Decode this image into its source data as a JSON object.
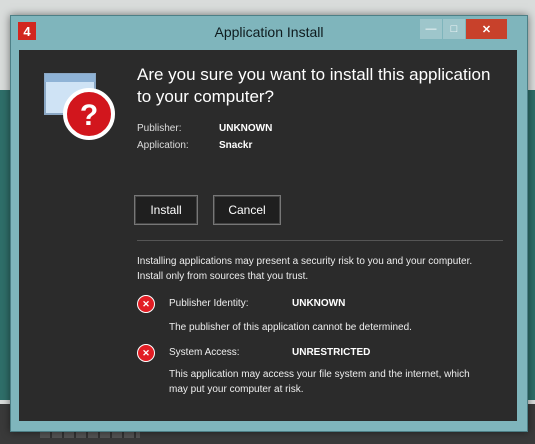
{
  "window": {
    "title": "Application Install",
    "app_icon_glyph": "4",
    "controls": {
      "minimize": "—",
      "maximize": "□",
      "close": "✕"
    }
  },
  "dialog": {
    "question": "Are you sure you want to install this application to your computer?",
    "publisher_label": "Publisher:",
    "publisher_value": "UNKNOWN",
    "application_label": "Application:",
    "application_value": "Snackr",
    "install_button": "Install",
    "cancel_button": "Cancel",
    "warning_text": "Installing applications may present a security risk to you and your computer. Install only from sources that you trust.",
    "risks": [
      {
        "label": "Publisher Identity:",
        "value": "UNKNOWN",
        "description": "The publisher of this application cannot be determined."
      },
      {
        "label": "System Access:",
        "value": "UNRESTRICTED",
        "description": "This application may access your file system and the internet, which may put your computer at risk."
      }
    ]
  },
  "colors": {
    "accent_red": "#e21d24",
    "frame": "#7fb5bc",
    "dialog_bg": "#2b2b2b"
  }
}
